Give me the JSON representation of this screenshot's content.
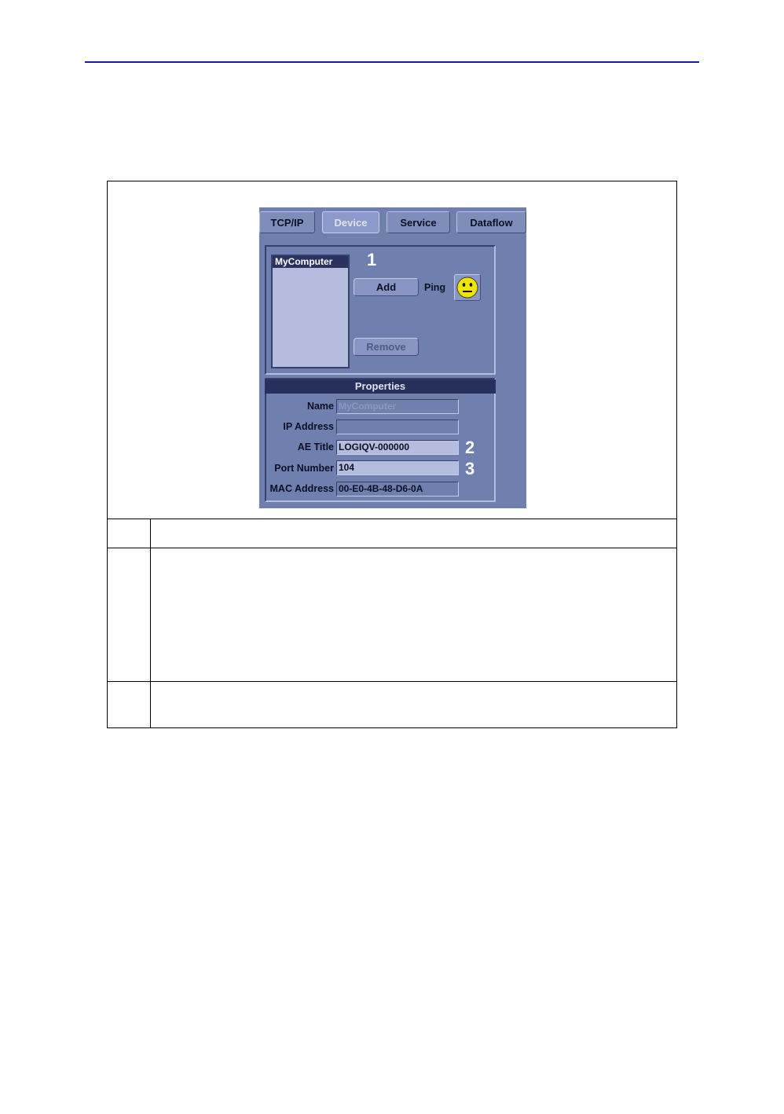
{
  "ui": {
    "tabs": [
      {
        "label": "TCP/IP"
      },
      {
        "label": "Device",
        "active": true
      },
      {
        "label": "Service"
      },
      {
        "label": "Dataflow"
      }
    ],
    "device_list": [
      "MyComputer"
    ],
    "buttons": {
      "add": "Add",
      "remove": "Remove",
      "ping_label": "Ping"
    },
    "callouts": {
      "one": "1",
      "two": "2",
      "three": "3"
    },
    "properties": {
      "title": "Properties",
      "fields": [
        {
          "label": "Name",
          "value": "MyComputer",
          "state": "disabled"
        },
        {
          "label": "IP Address",
          "value": "",
          "state": "readonly"
        },
        {
          "label": "AE Title",
          "value": "LOGIQV-000000",
          "state": "editable"
        },
        {
          "label": "Port Number",
          "value": "104",
          "state": "editable"
        },
        {
          "label": "MAC Address",
          "value": "00-E0-4B-48-D6-0A",
          "state": "readonly"
        }
      ]
    },
    "ping_status": "neutral-face-icon",
    "colors": {
      "panel": "#6f7fae",
      "header_rule": "#1a1aa8",
      "ping_face": "#f2e600"
    }
  }
}
